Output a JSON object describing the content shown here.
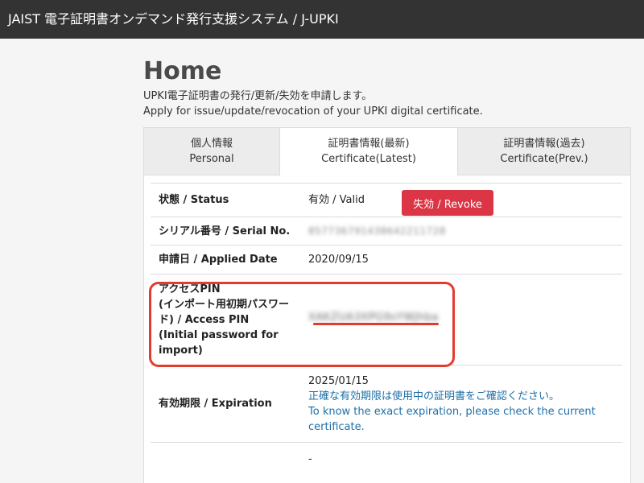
{
  "header": {
    "title": "JAIST 電子証明書オンデマンド発行支援システム / J-UPKI"
  },
  "page": {
    "title": "Home",
    "intro_ja": "UPKI電子証明書の発行/更新/失効を申請します。",
    "intro_en": "Apply for issue/update/revocation of your UPKI digital certificate."
  },
  "tabs": [
    {
      "label_ja": "個人情報",
      "label_en": "Personal"
    },
    {
      "label_ja": "証明書情報(最新)",
      "label_en": "Certificate(Latest)"
    },
    {
      "label_ja": "証明書情報(過去)",
      "label_en": "Certificate(Prev.)"
    }
  ],
  "rows": {
    "status": {
      "label": "状態 / Status",
      "value": "有効 / Valid",
      "button": "失効 / Revoke"
    },
    "serial": {
      "label": "シリアル番号 / Serial No.",
      "value": "857736791438642211728"
    },
    "applied": {
      "label": "申請日 / Applied Date",
      "value": "2020/09/15"
    },
    "pin": {
      "label_lines": [
        "アクセスPIN",
        "(インポート用初期パスワー",
        "ド) / Access PIN",
        "(Initial password for",
        "import)"
      ],
      "value": "XAKZUA3XPG9sYWJhba"
    },
    "expiration": {
      "label": "有効期限 / Expiration",
      "date": "2025/01/15",
      "note_ja": "正確な有効期限は使用中の証明書をご確認ください。",
      "note_en_1": "To know the exact expiration, please check the current",
      "note_en_2": "certificate."
    },
    "extra": {
      "value": "-"
    }
  },
  "colors": {
    "header_bg": "#333333",
    "revoke": "#dc3545",
    "highlight": "#e33b2e",
    "note": "#1e6fa8"
  }
}
